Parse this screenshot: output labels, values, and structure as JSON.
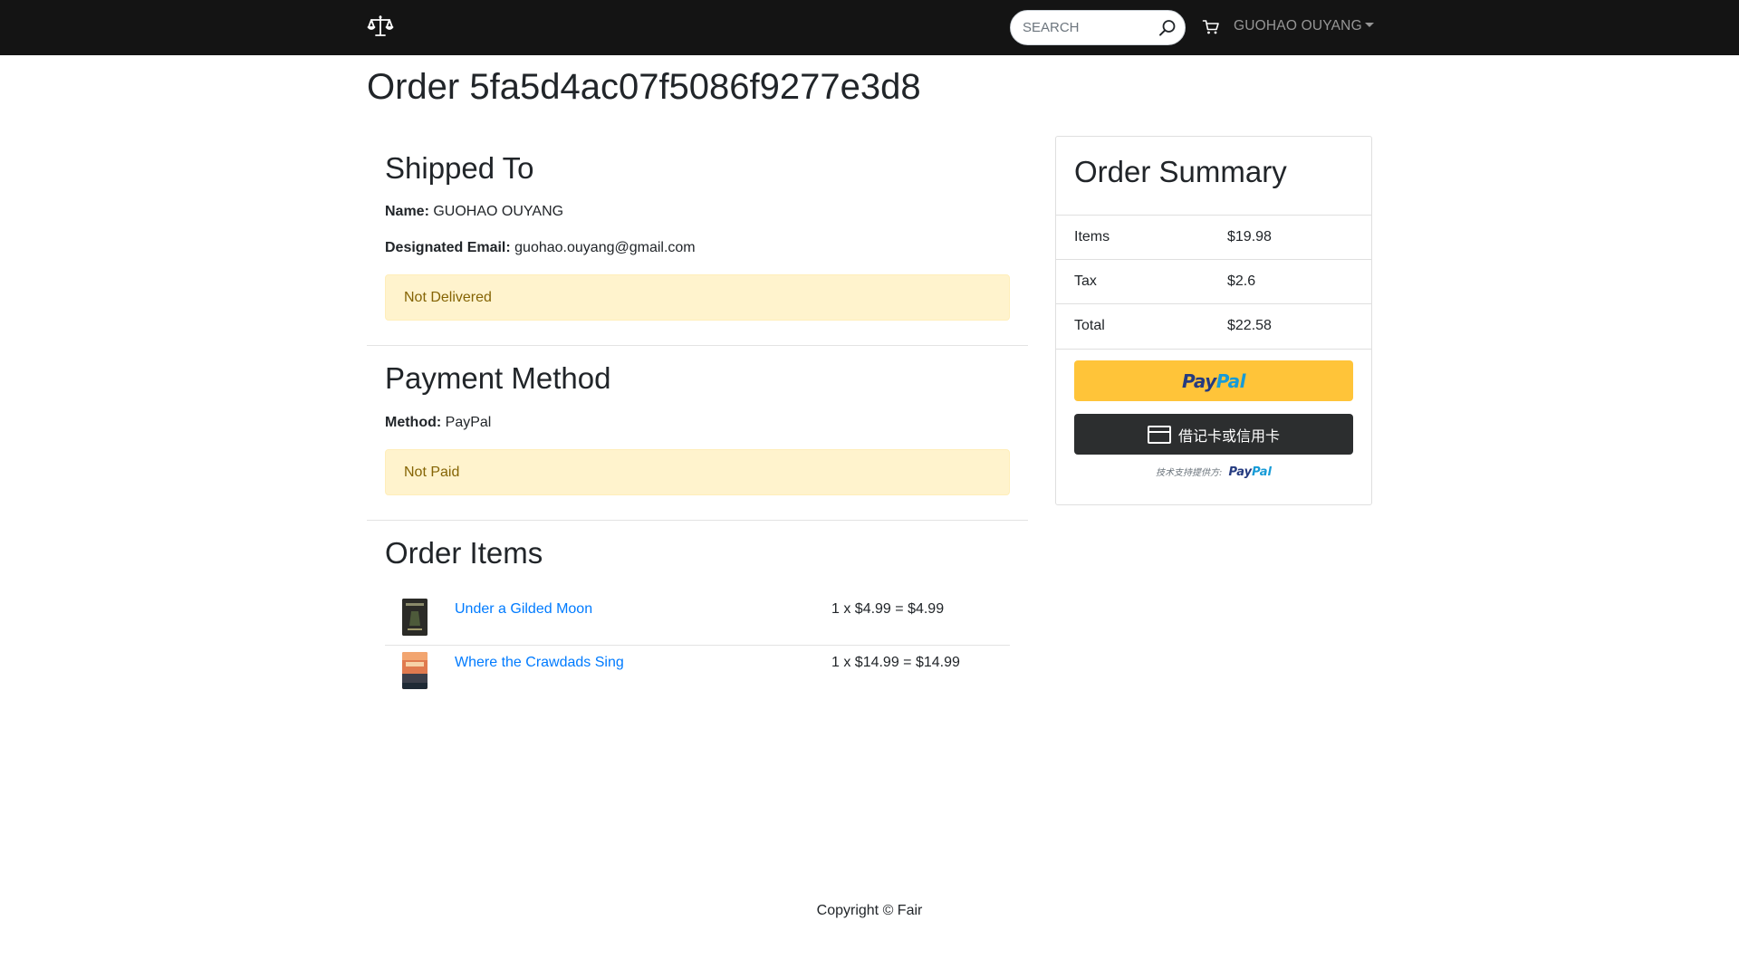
{
  "navbar": {
    "brand_icon": "scales-icon",
    "search_placeholder": "SEARCH",
    "search_icon": "search-icon",
    "cart_icon": "cart-icon",
    "user_name": "GUOHAO OUYANG"
  },
  "order": {
    "title": "Order 5fa5d4ac07f5086f9277e3d8"
  },
  "shipping": {
    "heading": "Shipped To",
    "name_label": "Name:",
    "name_value": "GUOHAO OUYANG",
    "email_label": "Designated Email:",
    "email_value": "guohao.ouyang@gmail.com",
    "status": "Not Delivered"
  },
  "payment": {
    "heading": "Payment Method",
    "method_label": "Method:",
    "method_value": "PayPal",
    "status": "Not Paid"
  },
  "items": {
    "heading": "Order Items",
    "list": [
      {
        "name": "Under a Gilded Moon",
        "price": "1 x $4.99 = $4.99",
        "thumb_color": "#2b2b27"
      },
      {
        "name": "Where the Crawdads Sing",
        "price": "1 x $14.99 = $14.99",
        "thumb_color": "#e07a4f"
      }
    ]
  },
  "summary": {
    "title": "Order Summary",
    "rows": [
      {
        "label": "Items",
        "value": "$19.98"
      },
      {
        "label": "Tax",
        "value": "$2.6"
      },
      {
        "label": "Total",
        "value": "$22.58"
      }
    ],
    "paypal_button": {
      "part1": "Pay",
      "part2": "Pal"
    },
    "card_button": "借记卡或信用卡",
    "powered_by": "技术支持提供方:",
    "powered_brand": {
      "part1": "Pay",
      "part2": "Pal"
    }
  },
  "footer": {
    "copyright": "Copyright © Fair"
  },
  "colors": {
    "navbar_bg": "#141414",
    "link": "#007bff",
    "alert_bg": "#fff3cd",
    "alert_text": "#856404",
    "paypal_yellow": "#ffc439",
    "paypal_dark_blue": "#253b80",
    "paypal_light_blue": "#179bd7",
    "card_button_bg": "#2c2e2f"
  }
}
